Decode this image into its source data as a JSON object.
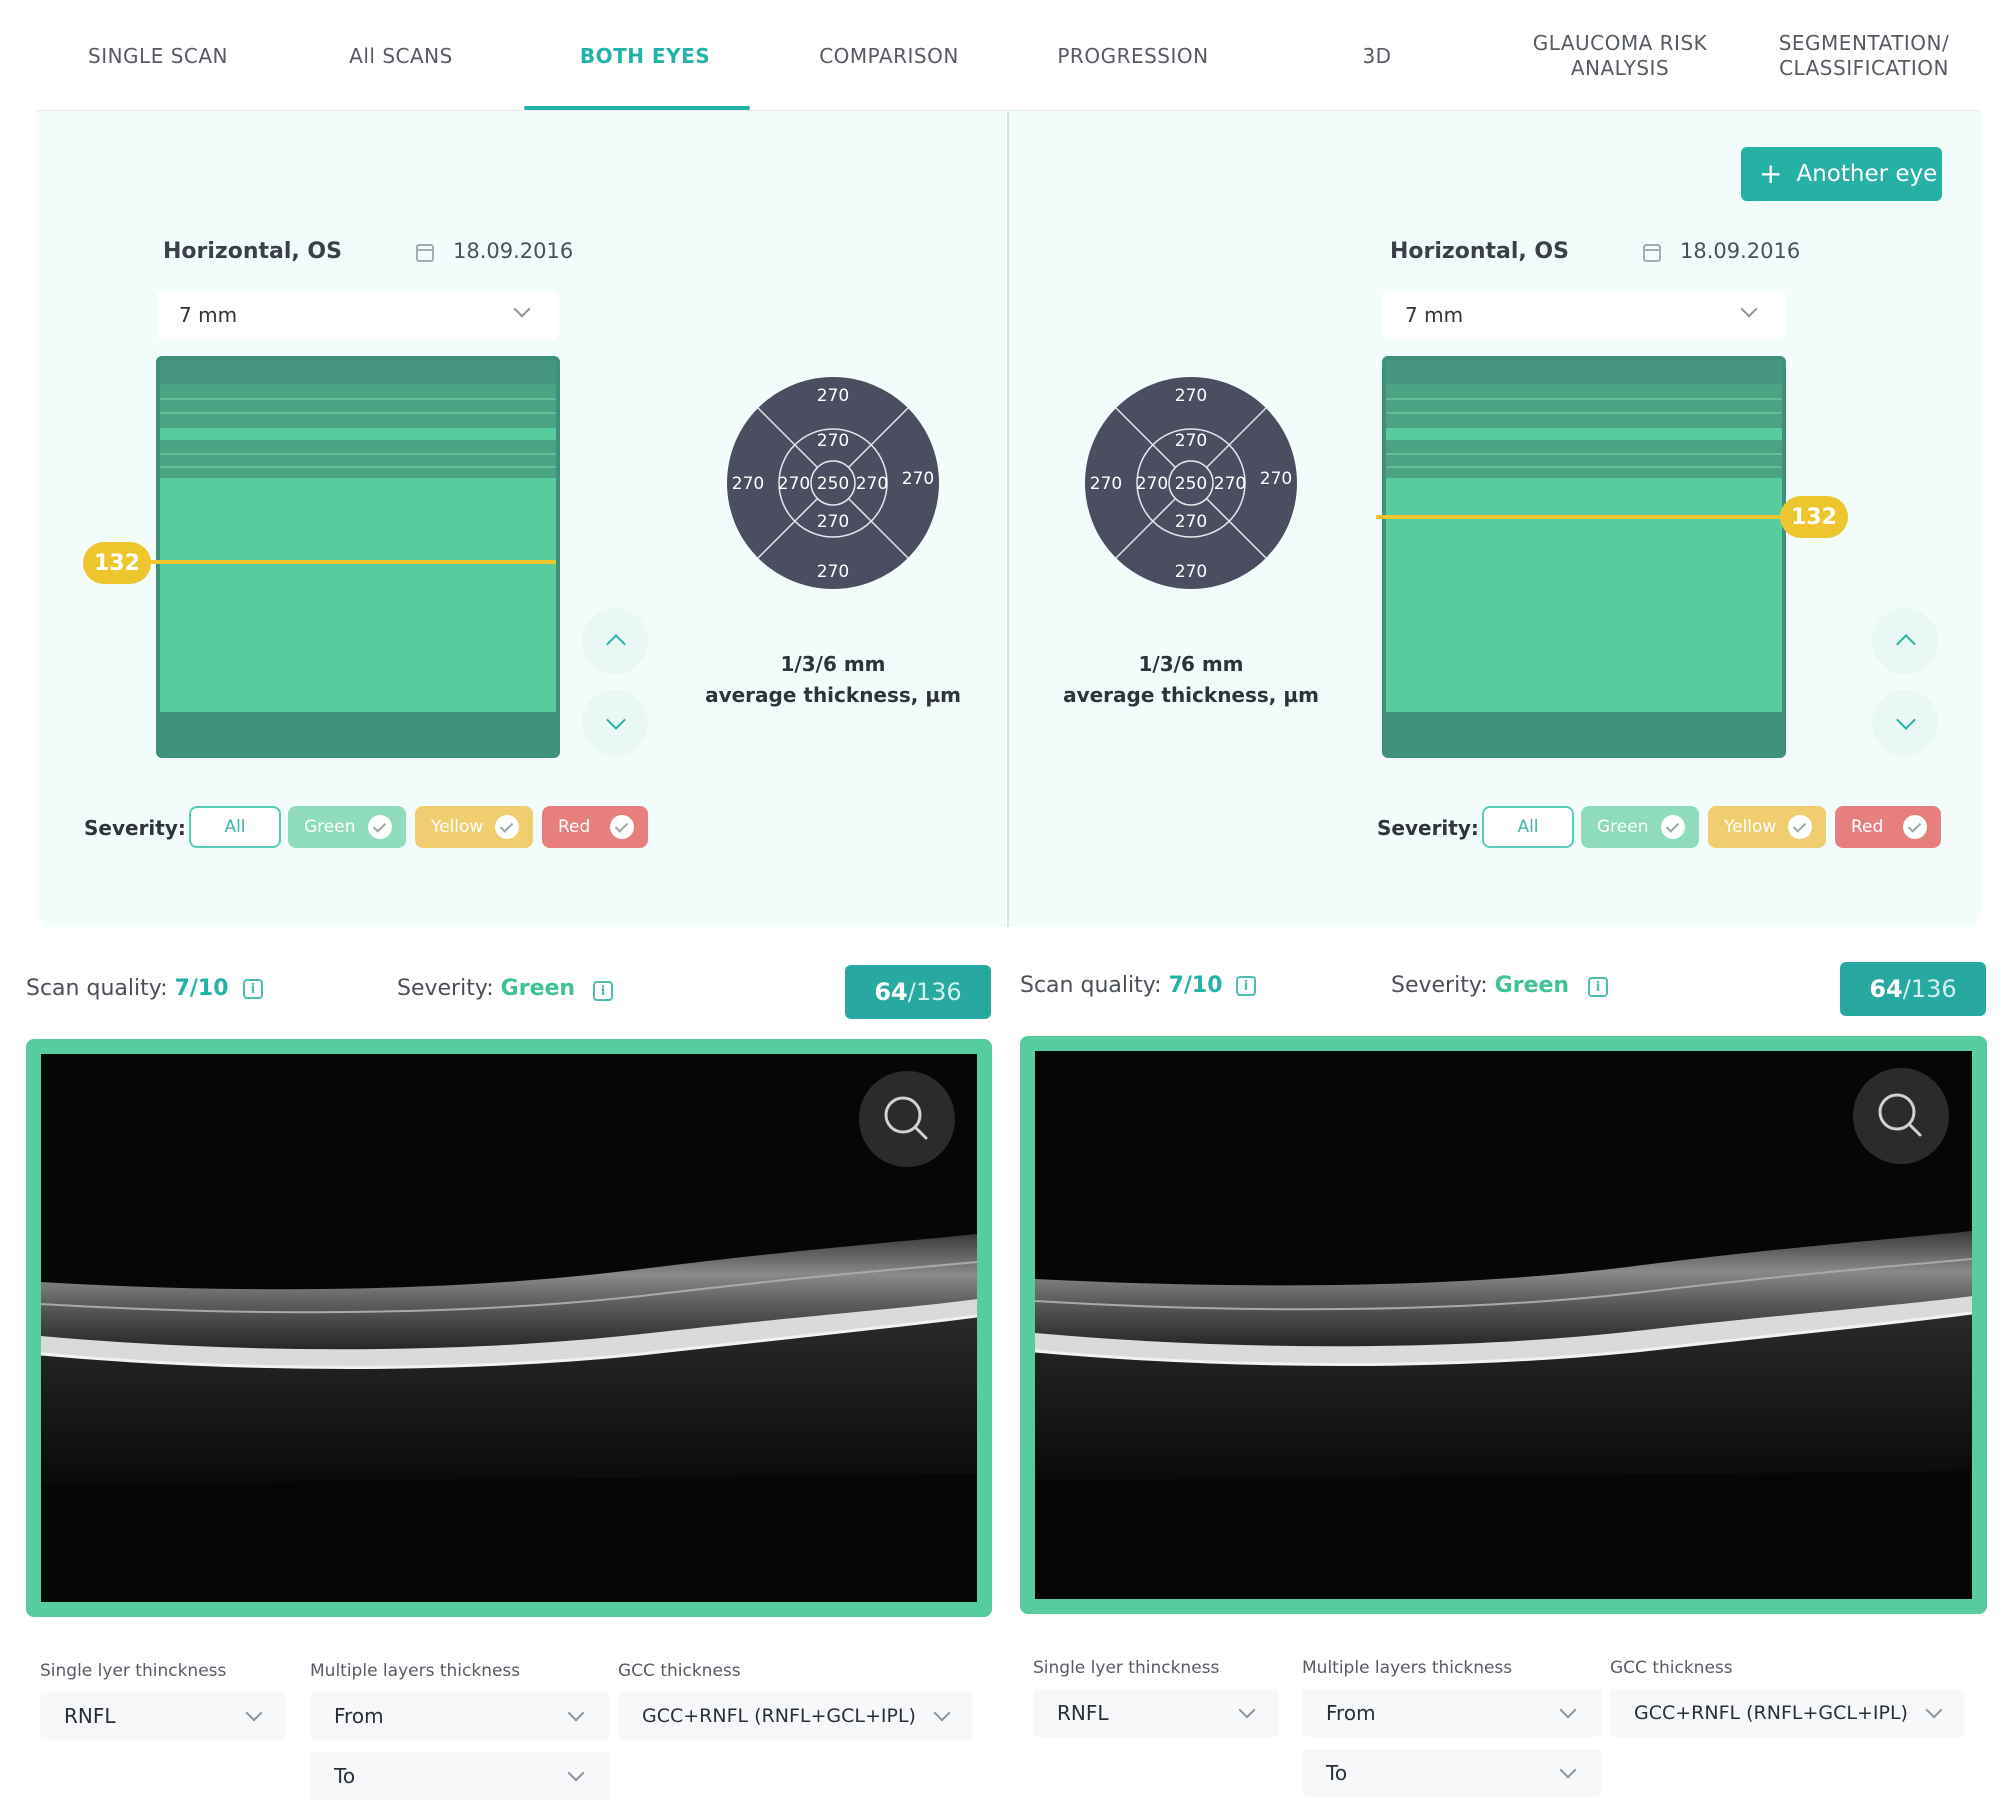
{
  "tabs": [
    {
      "label": "SINGLE SCAN"
    },
    {
      "label": "All SCANS"
    },
    {
      "label": "BOTH EYES"
    },
    {
      "label": "COMPARISON"
    },
    {
      "label": "PROGRESSION"
    },
    {
      "label": "3D"
    },
    {
      "label": "GLAUCOMA RISK ANALYSIS"
    },
    {
      "label": "SEGMENTATION/ CLASSIFICATION"
    }
  ],
  "active_tab": "BOTH EYES",
  "add_eye_label": "Another eye",
  "colors": {
    "accent": "#23b3a6",
    "panel_bg": "#f2fdfb",
    "green": "#57cc9f",
    "yellow": "#ecc62c",
    "red": "#e87f7f",
    "dial": "#4b4e60"
  },
  "eyes": [
    {
      "title": "Horizontal, OS",
      "date": "18.09.2016",
      "scan_size": "7 mm",
      "marker_value": "132",
      "thickness_map": {
        "center": "250",
        "inner": {
          "top": "270",
          "left": "270",
          "right": "270",
          "bottom": "270"
        },
        "outer": {
          "top": "270",
          "left": "270",
          "right": "270",
          "bottom": "270"
        }
      },
      "avg_label_1": "1/3/6 mm",
      "avg_label_2": "average thickness, µm",
      "severity": {
        "label": "Severity:",
        "chips": [
          "All",
          "Green",
          "Yellow",
          "Red"
        ]
      },
      "scan_quality_label": "Scan quality:",
      "scan_quality_value": "7/10",
      "severity_label": "Severity:",
      "severity_value": "Green",
      "slice_current": "64",
      "slice_total": "/136",
      "controls": {
        "single_label": "Single lyer thinckness",
        "single_value": "RNFL",
        "multiple_label": "Multiple layers thickness",
        "from_value": "From",
        "to_value": "To",
        "gcc_label": "GCC thickness",
        "gcc_value": "GCC+RNFL (RNFL+GCL+IPL)"
      }
    },
    {
      "title": "Horizontal, OS",
      "date": "18.09.2016",
      "scan_size": "7 mm",
      "marker_value": "132",
      "thickness_map": {
        "center": "250",
        "inner": {
          "top": "270",
          "left": "270",
          "right": "270",
          "bottom": "270"
        },
        "outer": {
          "top": "270",
          "left": "270",
          "right": "270",
          "bottom": "270"
        }
      },
      "avg_label_1": "1/3/6 mm",
      "avg_label_2": "average thickness, µm",
      "severity": {
        "label": "Severity:",
        "chips": [
          "All",
          "Green",
          "Yellow",
          "Red"
        ]
      },
      "scan_quality_label": "Scan quality:",
      "scan_quality_value": "7/10",
      "severity_label": "Severity:",
      "severity_value": "Green",
      "slice_current": "64",
      "slice_total": "/136",
      "controls": {
        "single_label": "Single lyer thinckness",
        "single_value": "RNFL",
        "multiple_label": "Multiple layers thickness",
        "from_value": "From",
        "to_value": "To",
        "gcc_label": "GCC thickness",
        "gcc_value": "GCC+RNFL (RNFL+GCL+IPL)"
      }
    }
  ]
}
